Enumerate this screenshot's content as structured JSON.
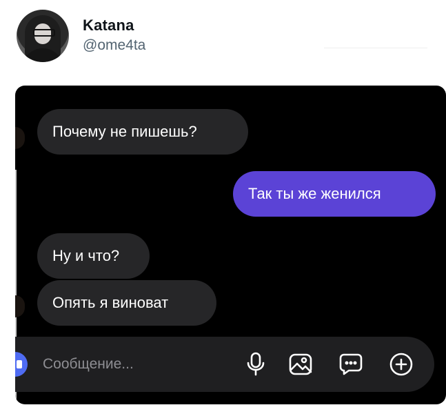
{
  "post": {
    "display_name": "Katana",
    "handle": "@ome4ta"
  },
  "chat": {
    "messages": [
      {
        "direction": "incoming",
        "text": "Почему не пишешь?"
      },
      {
        "direction": "outgoing",
        "text": "Так ты же женился"
      },
      {
        "direction": "incoming",
        "text": "Ну и что?"
      },
      {
        "direction": "incoming",
        "text": "Опять я виноват"
      }
    ],
    "composer": {
      "placeholder": "Сообщение...",
      "icons": [
        "camera-icon",
        "microphone-icon",
        "image-icon",
        "sticker-icon",
        "add-icon"
      ]
    }
  },
  "colors": {
    "outgoing_bubble": "#5b43d6",
    "incoming_bubble": "#262628",
    "chat_background": "#000000",
    "composer_background": "#1f1f21",
    "camera_button": "#4f6cf2",
    "handle_text": "#536471",
    "name_text": "#0f1419"
  }
}
